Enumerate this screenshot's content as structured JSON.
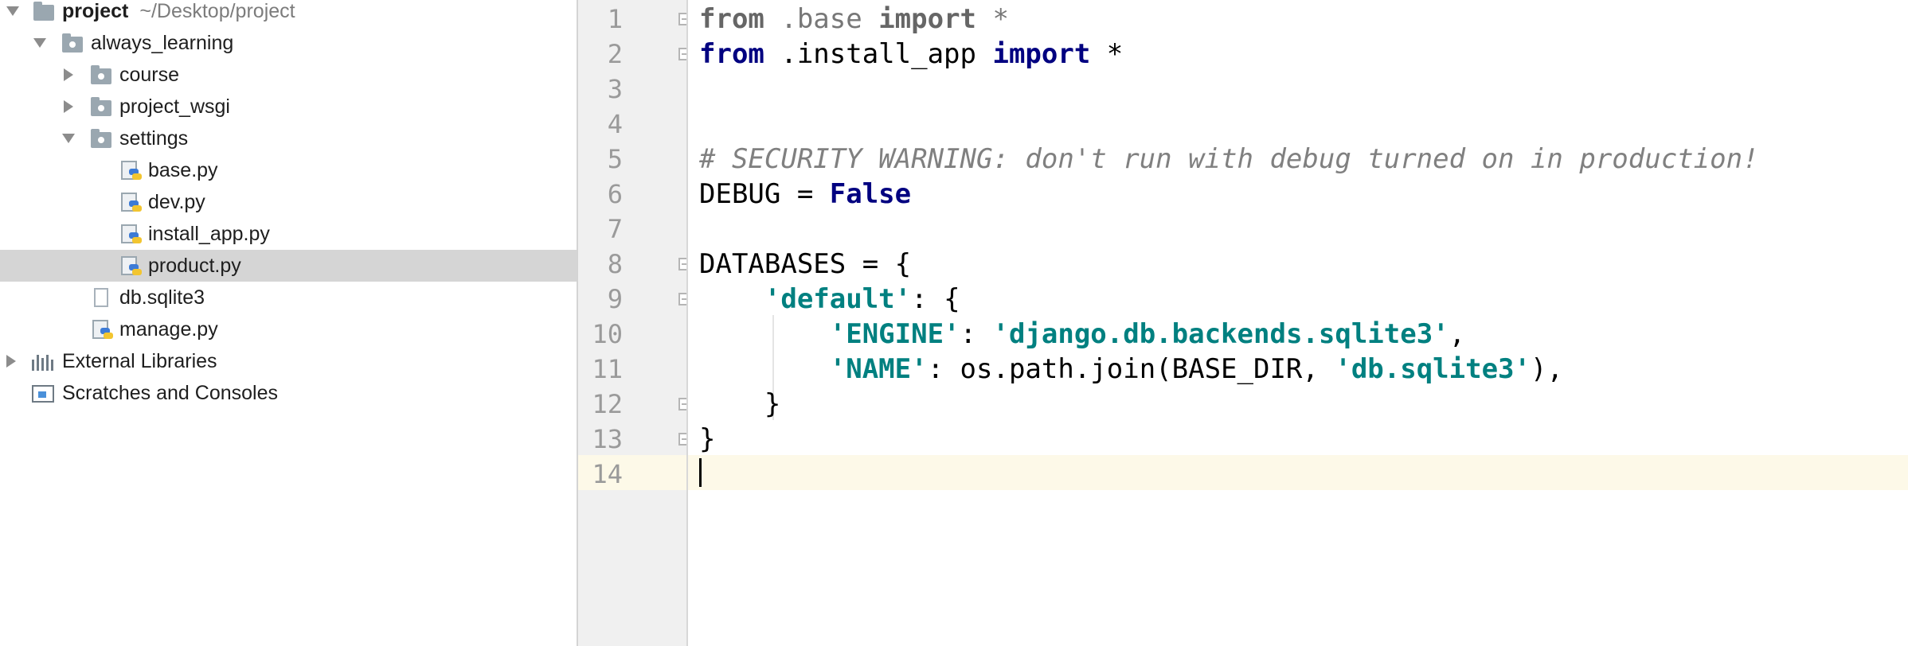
{
  "tree": {
    "root": {
      "name": "project",
      "path": "~/Desktop/project"
    },
    "items": [
      {
        "name": "always_learning"
      },
      {
        "name": "course"
      },
      {
        "name": "project_wsgi"
      },
      {
        "name": "settings"
      },
      {
        "name": "base.py"
      },
      {
        "name": "dev.py"
      },
      {
        "name": "install_app.py"
      },
      {
        "name": "product.py",
        "selected": true
      },
      {
        "name": "db.sqlite3"
      },
      {
        "name": "manage.py"
      },
      {
        "name": "External Libraries"
      },
      {
        "name": "Scratches and Consoles"
      }
    ]
  },
  "editor": {
    "line_numbers": [
      "1",
      "2",
      "3",
      "4",
      "5",
      "6",
      "7",
      "8",
      "9",
      "10",
      "11",
      "12",
      "13",
      "14"
    ],
    "tokens": {
      "l1": {
        "kw1": "from",
        "mod": " .base ",
        "kw2": "import",
        "rest": " *"
      },
      "l2": {
        "kw1": "from",
        "mod": " .install_app ",
        "kw2": "import",
        "rest": " *"
      },
      "l5": {
        "comment": "# SECURITY WARNING: don't run with debug turned on in production!"
      },
      "l6": {
        "name": "DEBUG = ",
        "value": "False"
      },
      "l8": {
        "text": "DATABASES = {"
      },
      "l9": {
        "indent": "    ",
        "key": "'default'",
        "rest": ": {"
      },
      "l10": {
        "indent": "        ",
        "key": "'ENGINE'",
        "sep": ": ",
        "value": "'django.db.backends.sqlite3'",
        "rest": ","
      },
      "l11": {
        "indent": "        ",
        "key": "'NAME'",
        "sep": ": os.path.join(BASE_DIR, ",
        "value": "'db.sqlite3'",
        "rest": "),"
      },
      "l12": {
        "text": "    }"
      },
      "l13": {
        "text": "}"
      }
    }
  },
  "colors": {
    "selection": "#d5d5d5",
    "keyword": "#000080",
    "string": "#008080",
    "comment": "#808080",
    "caret_line": "#fdf9e8"
  }
}
